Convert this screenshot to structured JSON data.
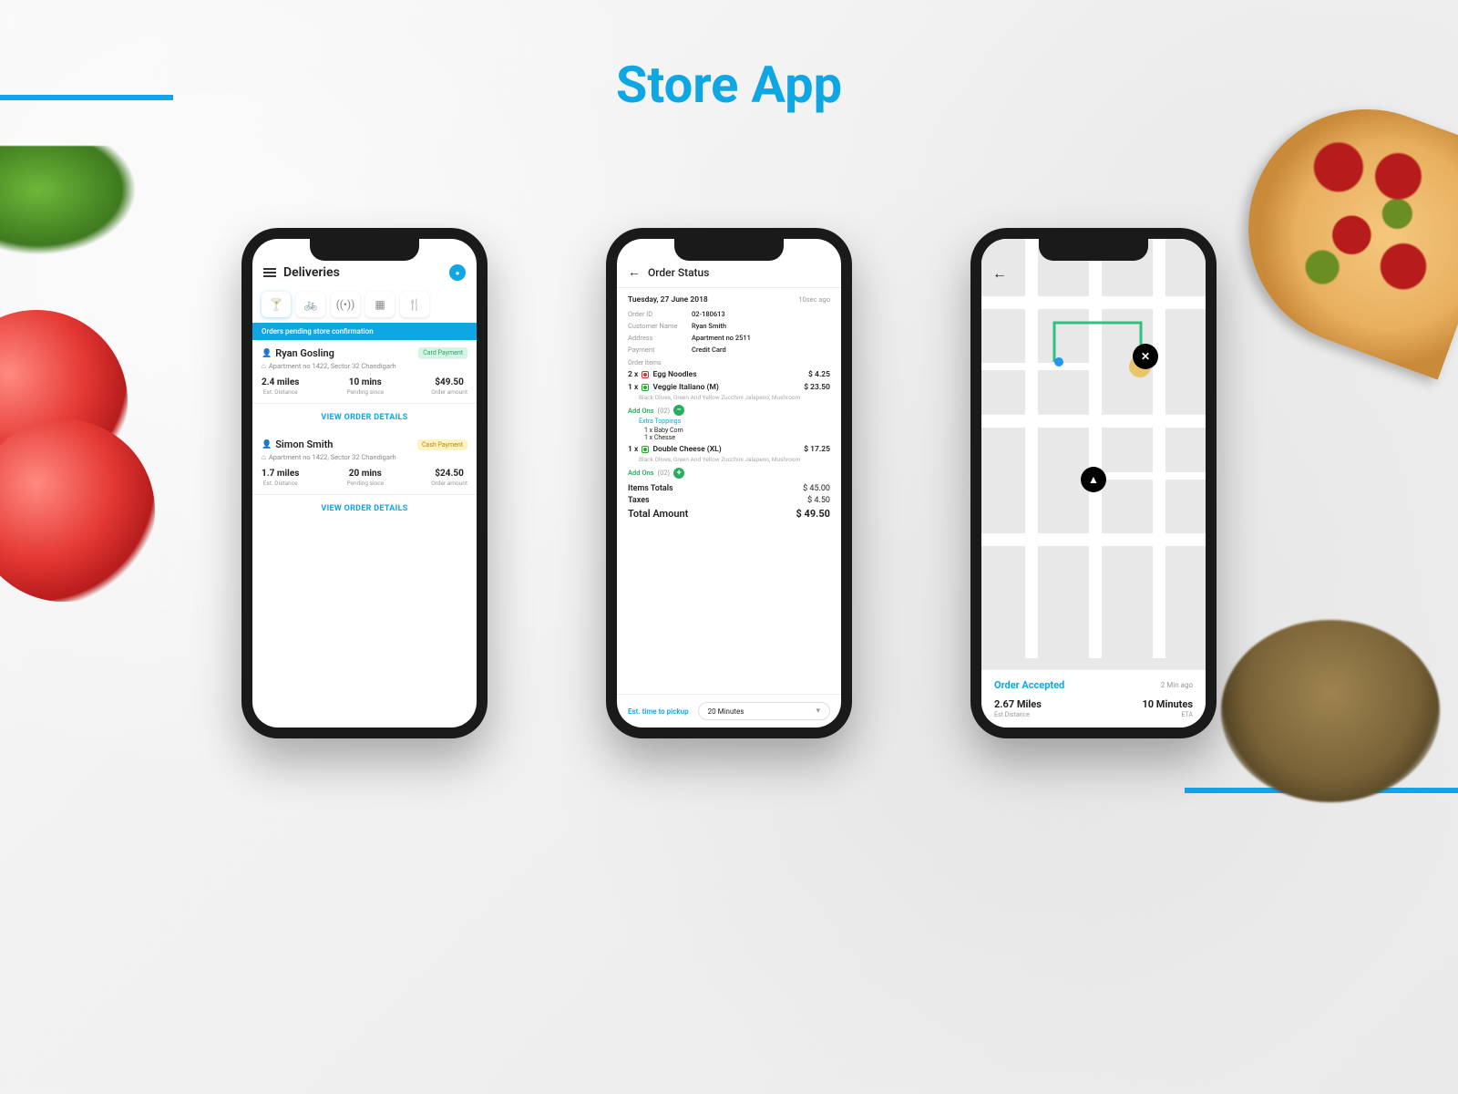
{
  "title": "Store App",
  "screen1": {
    "header": "Deliveries",
    "banner": "Orders pending store confirmation",
    "orders": [
      {
        "name": "Ryan Gosling",
        "payment_label": "Card Payment",
        "payment_kind": "card",
        "address": "Apartment no 1422, Sector 32 Chandigarh",
        "distance": "2.4 miles",
        "distance_label": "Est. Distance",
        "pending": "10 mins",
        "pending_label": "Pending since",
        "amount": "$49.50",
        "amount_label": "Order amount",
        "details_label": "VIEW ORDER DETAILS"
      },
      {
        "name": "Simon Smith",
        "payment_label": "Cash Payment",
        "payment_kind": "cash",
        "address": "Apartment no 1422, Sector 32 Chandigarh",
        "distance": "1.7 miles",
        "distance_label": "Est. Distance",
        "pending": "20 mins",
        "pending_label": "Pending since",
        "amount": "$24.50",
        "amount_label": "Order amount",
        "details_label": "VIEW ORDER DETAILS"
      }
    ]
  },
  "screen2": {
    "header": "Order Status",
    "date": "Tuesday, 27 June 2018",
    "time_ago": "10sec ago",
    "fields": {
      "order_id_k": "Order ID",
      "order_id_v": "02-180613",
      "customer_k": "Customer Name",
      "customer_v": "Ryan Smith",
      "address_k": "Address",
      "address_v": "Apartment no 2511",
      "payment_k": "Payment",
      "payment_v": "Credit Card"
    },
    "items_header": "Order Items",
    "item1_qty": "2 x ",
    "item1_name": "Egg Noodles",
    "item1_price": "$ 4.25",
    "item2_qty": "1 x ",
    "item2_name": "Veggie Italiano (M)",
    "item2_price": "$ 23.50",
    "item2_desc": "Black Olives, Green And Yellow Zucchini\nJalapeno, Mushroom",
    "addons_label": "Add Ons",
    "addons_count": "(02)",
    "toppings_header": "Extra Toppings",
    "topping1": "1 x   Baby Corn",
    "topping2": "1 x   Chesse",
    "item3_qty": "1 x ",
    "item3_name": "Double Cheese (XL)",
    "item3_price": "$ 17.25",
    "item3_desc": "Black Olives, Green And Yellow Zucchini\nJalapeno, Mushroom",
    "totals": {
      "items_k": "Items Totals",
      "items_v": "$ 45.00",
      "taxes_k": "Taxes",
      "taxes_v": "$ 4.50",
      "total_k": "Total Amount",
      "total_v": "$ 49.50"
    },
    "footer_label": "Est. time to pickup",
    "pickup_value": "20 Minutes"
  },
  "screen3": {
    "status": "Order Accepted",
    "time_ago": "2 Min ago",
    "distance": "2.67 Miles",
    "distance_label": "Est Distance",
    "eta": "10 Minutes",
    "eta_label": "ETA"
  }
}
